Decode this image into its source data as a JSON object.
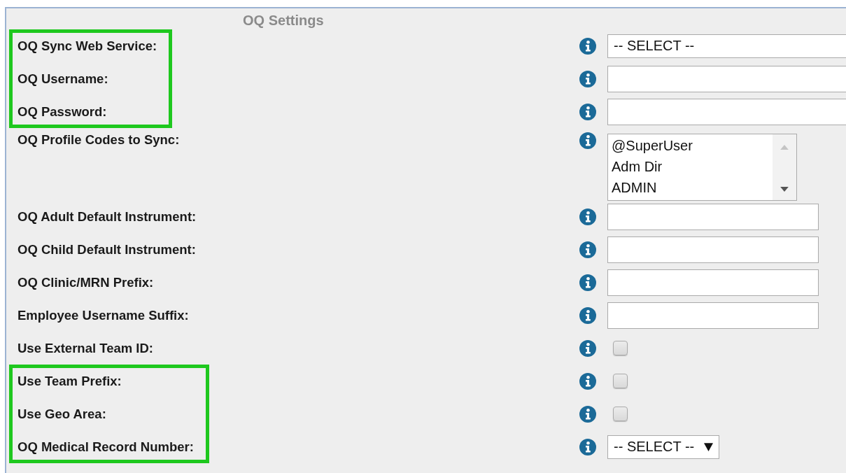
{
  "title": "OQ Settings",
  "groups": [
    {
      "highlighted": true,
      "rows": [
        {
          "label": "OQ Sync Web Service:",
          "kind": "select",
          "value": "-- SELECT --",
          "wide": true
        },
        {
          "label": "OQ Username:",
          "kind": "text",
          "wide": true
        },
        {
          "label": "OQ Password:",
          "kind": "text",
          "wide": true
        }
      ]
    },
    {
      "highlighted": false,
      "rows": [
        {
          "label": "OQ Profile Codes to Sync:",
          "kind": "listbox",
          "options": [
            "@SuperUser",
            "Adm Dir",
            "ADMIN"
          ]
        },
        {
          "label": "OQ Adult Default Instrument:",
          "kind": "text",
          "wide": false
        },
        {
          "label": "OQ Child Default Instrument:",
          "kind": "text",
          "wide": false
        },
        {
          "label": "OQ Clinic/MRN Prefix:",
          "kind": "text",
          "wide": false
        },
        {
          "label": "Employee Username Suffix:",
          "kind": "text",
          "wide": false
        },
        {
          "label": "Use External Team ID:",
          "kind": "checkbox",
          "checked": false
        }
      ]
    },
    {
      "highlighted": true,
      "rows": [
        {
          "label": "Use Team Prefix:",
          "kind": "checkbox",
          "checked": false
        },
        {
          "label": "Use Geo Area:",
          "kind": "checkbox",
          "checked": false
        },
        {
          "label": "OQ Medical Record Number:",
          "kind": "select",
          "value": "-- SELECT --",
          "wide": false
        }
      ]
    }
  ]
}
